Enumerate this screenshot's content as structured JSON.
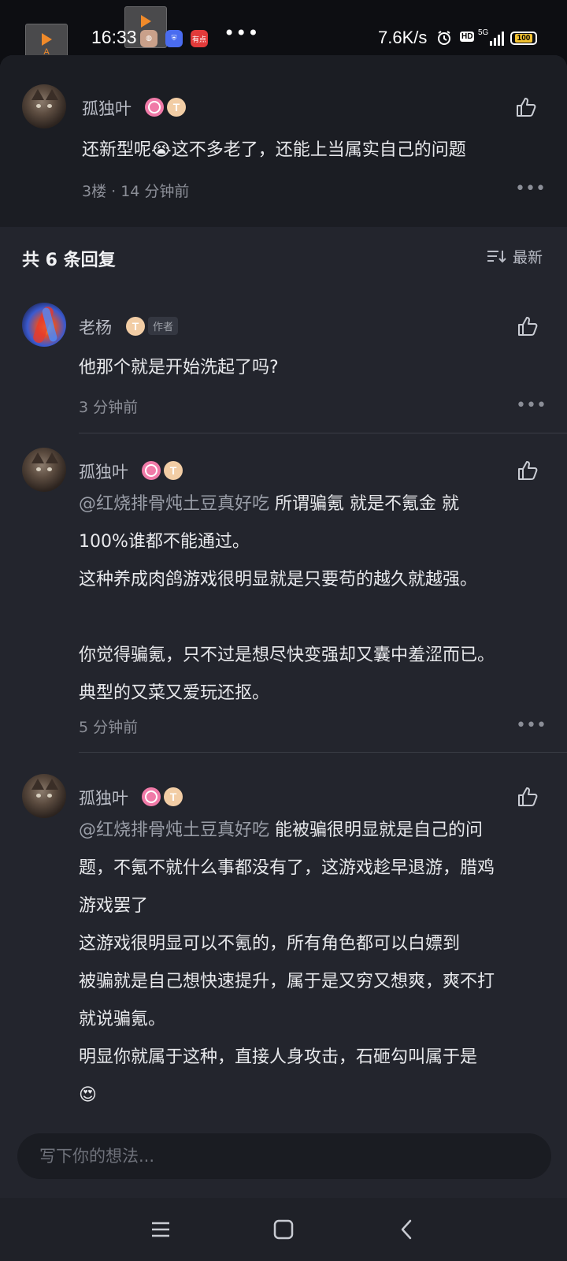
{
  "status_bar": {
    "float_icon_label": "A",
    "time": "16:33",
    "app_icon_3_text": "有点",
    "net_speed": "7.6K/s",
    "hd_label": "HD",
    "network": "5G",
    "battery": "100"
  },
  "parent_comment": {
    "username": "孤独叶",
    "badge_text": "T",
    "text_before_emoji": "还新型呢",
    "emoji": "😭",
    "text_after_emoji": "这不多老了，还能上当属实自己的问题",
    "meta": "3楼 · 14 分钟前"
  },
  "replies_header": {
    "title": "共 6 条回复",
    "sort_label": "最新"
  },
  "replies": [
    {
      "username": "老杨",
      "badge_text": "T",
      "author_tag": "作者",
      "text": "他那个就是开始洗起了吗?",
      "meta": "3 分钟前"
    },
    {
      "username": "孤独叶",
      "badge_text": "T",
      "mention": "@红烧排骨炖土豆真好吃",
      "lines": [
        " 所谓骗氪 就是不氪金 就",
        "100%谁都不能通过。",
        "这种养成肉鸽游戏很明显就是只要苟的越久就越强。",
        "",
        "你觉得骗氪，只不过是想尽快变强却又囊中羞涩而已。",
        "典型的又菜又爱玩还抠。"
      ],
      "meta": "5 分钟前"
    },
    {
      "username": "孤独叶",
      "badge_text": "T",
      "mention": "@红烧排骨炖土豆真好吃",
      "lines": [
        " 能被骗很明显就是自己的问",
        "题，不氪不就什么事都没有了，这游戏趁早退游，腊鸡",
        "游戏罢了",
        "这游戏很明显可以不氪的，所有角色都可以白嫖到",
        "被骗就是自己想快速提升，属于是又穷又想爽，爽不打",
        "就说骗氪。",
        "明显你就属于这种，直接人身攻击，石砸勾叫属于是"
      ],
      "emoji": "😍"
    }
  ],
  "input": {
    "placeholder": "写下你的想法..."
  },
  "colors": {
    "background": "#23252d",
    "parent_bg": "#1b1d23",
    "text": "#e8e9ec",
    "meta": "#8b8e97"
  }
}
